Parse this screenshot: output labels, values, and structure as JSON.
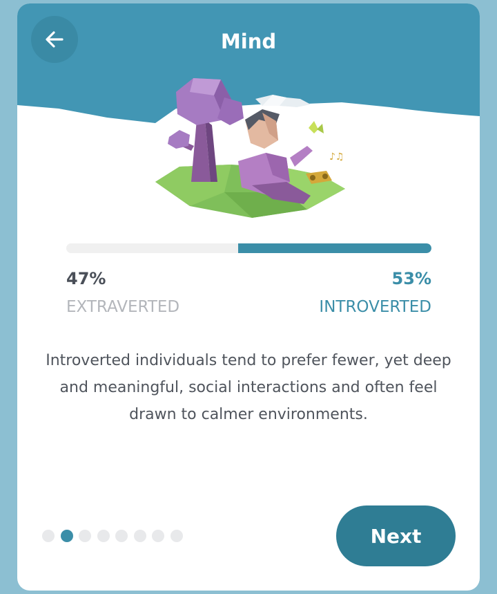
{
  "header": {
    "title": "Mind",
    "back_icon": "arrow-left-icon",
    "color": "#4296b4"
  },
  "illustration": {
    "name": "introvert-scene-illustration"
  },
  "result": {
    "left": {
      "percent": "47%",
      "label": "EXTRAVERTED"
    },
    "right": {
      "percent": "53%",
      "label": "INTROVERTED"
    },
    "fill_fraction": 0.53,
    "accent_color": "#3b8ea8"
  },
  "description": "Introverted individuals tend to prefer fewer, yet deep and meaningful, social interactions and often feel drawn to calmer environments.",
  "pagination": {
    "total": 8,
    "active_index": 1
  },
  "actions": {
    "next_label": "Next"
  }
}
